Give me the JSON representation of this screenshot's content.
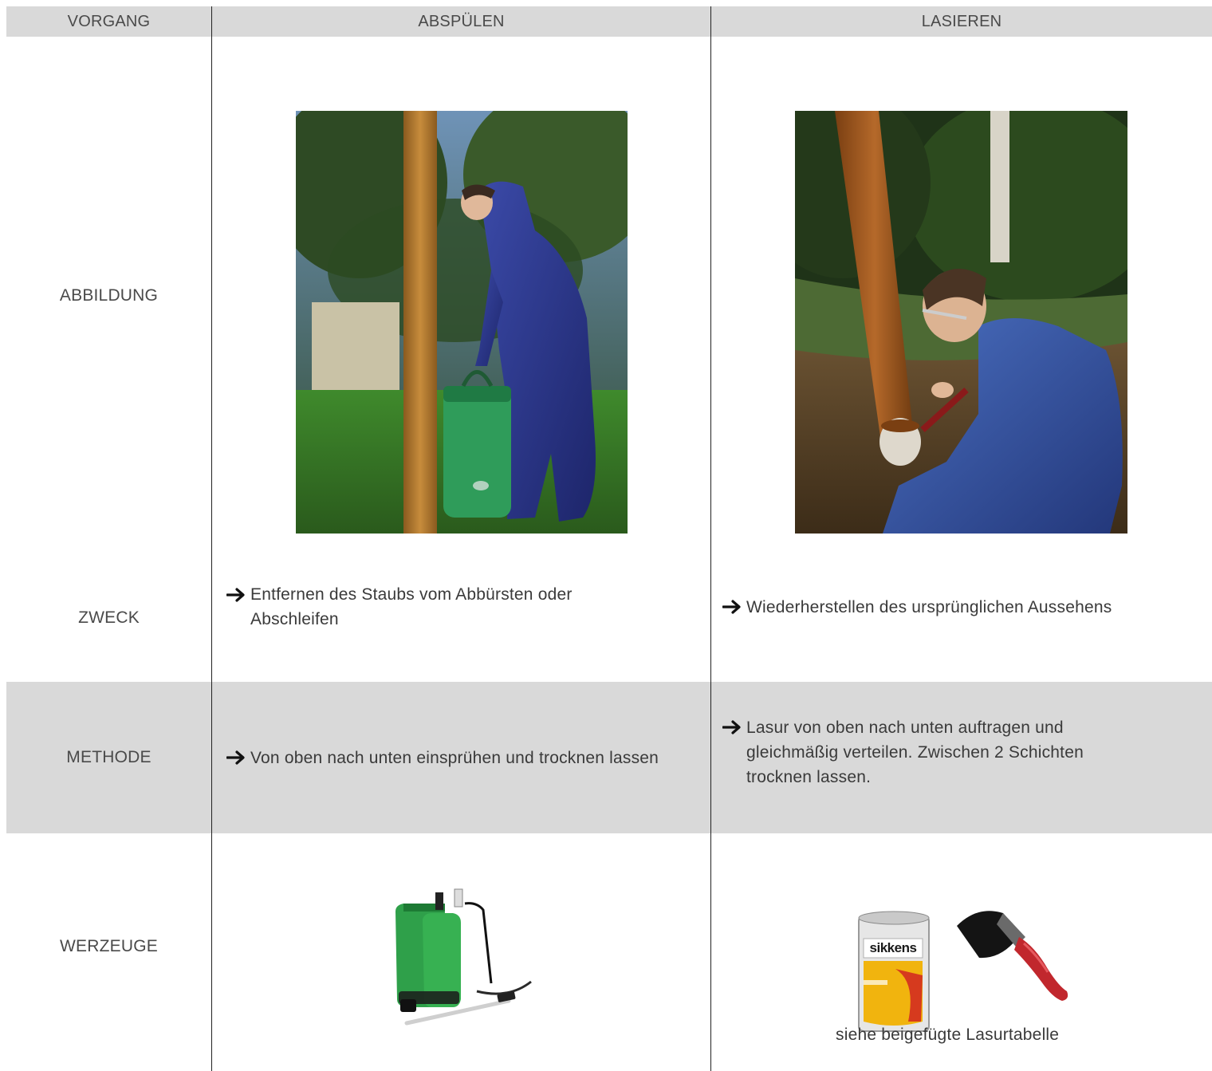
{
  "header": {
    "col0": "VORGANG",
    "col1": "ABSPÜLEN",
    "col2": "LASIEREN"
  },
  "rows": {
    "abbildung": {
      "label": "ABBILDUNG"
    },
    "zweck": {
      "label": "ZWECK",
      "col1": "Entfernen des Staubs vom Abbürsten oder Abschleifen",
      "col2": "Wiederherstellen des ursprünglichen Aussehens"
    },
    "methode": {
      "label": "METHODE",
      "col1": "Von oben nach unten einsprühen und trocknen lassen",
      "col2": "Lasur von oben nach unten auftragen und gleichmäßig verteilen. Zwischen 2 Schichten trocknen lassen."
    },
    "werkzeuge": {
      "label": "WERZEUGE",
      "col2_caption": "siehe beigefügte Lasurtabelle",
      "can_brand": "sikkens"
    }
  },
  "icons": {
    "bullet": "arrow-right-icon"
  },
  "colors": {
    "grey_band": "#d9d9d9",
    "divider": "#222222",
    "text": "#3a3a3a"
  }
}
